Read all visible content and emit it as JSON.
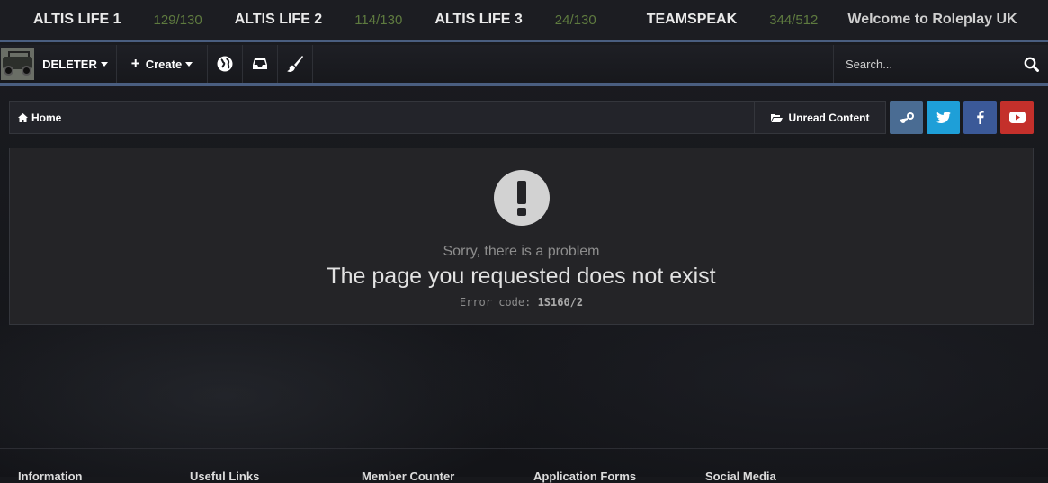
{
  "server_bar": {
    "servers": [
      {
        "name": "ALTIS LIFE 1",
        "count": "129/130"
      },
      {
        "name": "ALTIS LIFE 2",
        "count": "114/130"
      },
      {
        "name": "ALTIS LIFE 3",
        "count": "24/130"
      },
      {
        "name": "TEAMSPEAK",
        "count": "344/512"
      }
    ],
    "welcome": "Welcome to Roleplay UK",
    "count_color": "#5e7a3f"
  },
  "nav": {
    "user_label": "DELETER",
    "create_label": "Create",
    "icons": [
      "globe-icon",
      "inbox-icon",
      "brush-icon"
    ],
    "search_placeholder": "Search..."
  },
  "breadcrumb": {
    "home_label": "Home",
    "unread_label": "Unread Content",
    "social": [
      "steam-icon",
      "twitter-icon",
      "facebook-icon",
      "youtube-icon"
    ]
  },
  "error": {
    "sorry": "Sorry, there is a problem",
    "title": "The page you requested does not exist",
    "code_label": "Error code:",
    "code_value": "1S160/2"
  },
  "footer": {
    "headings": [
      "Information",
      "Useful Links",
      "Member Counter",
      "Application Forms",
      "Social Media"
    ]
  },
  "colors": {
    "accent": "#4a5e80",
    "background": "#17181c",
    "panel": "#242427"
  }
}
